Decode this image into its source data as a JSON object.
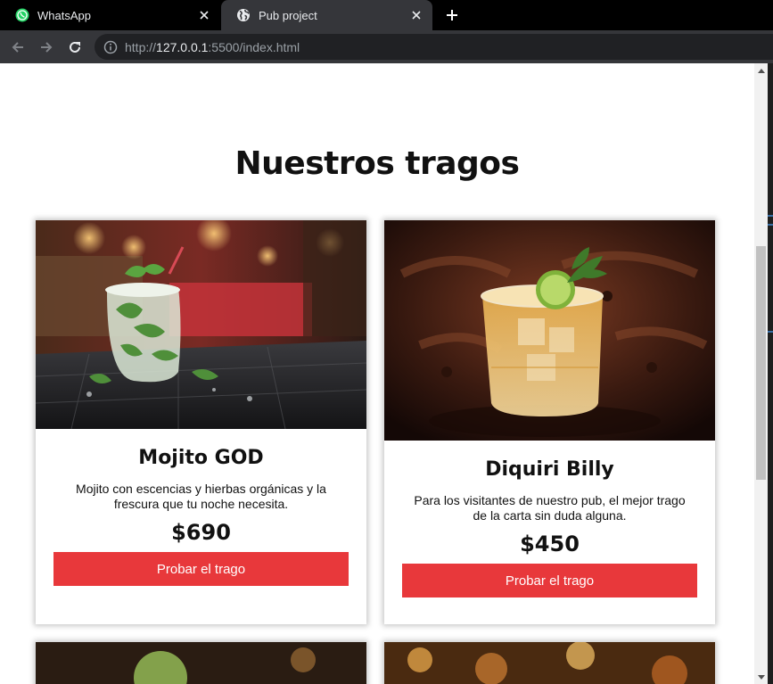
{
  "browser": {
    "tabs": [
      {
        "title": "WhatsApp",
        "icon": "whatsapp-icon",
        "active": false
      },
      {
        "title": "Pub project",
        "icon": "globe-icon",
        "active": true
      }
    ],
    "url": {
      "scheme": "http://",
      "host": "127.0.0.1",
      "rest": ":5500/index.html"
    }
  },
  "page": {
    "heading": "Nuestros tragos",
    "drinks": [
      {
        "name": "Mojito GOD",
        "description": "Mojito con escencias y hierbas orgánicas y la frescura que tu noche necesita.",
        "price": "$690",
        "button": "Probar el trago",
        "image": "mojito-photo"
      },
      {
        "name": "Diquiri Billy",
        "description": "Para los visitantes de nuestro pub, el mejor trago de la carta sin duda alguna.",
        "price": "$450",
        "button": "Probar el trago",
        "image": "diquiri-photo"
      }
    ]
  },
  "colors": {
    "accent": "#e8383b",
    "tab_active": "#35363a",
    "tabstrip": "#000000",
    "page_bg": "#ffffff"
  }
}
